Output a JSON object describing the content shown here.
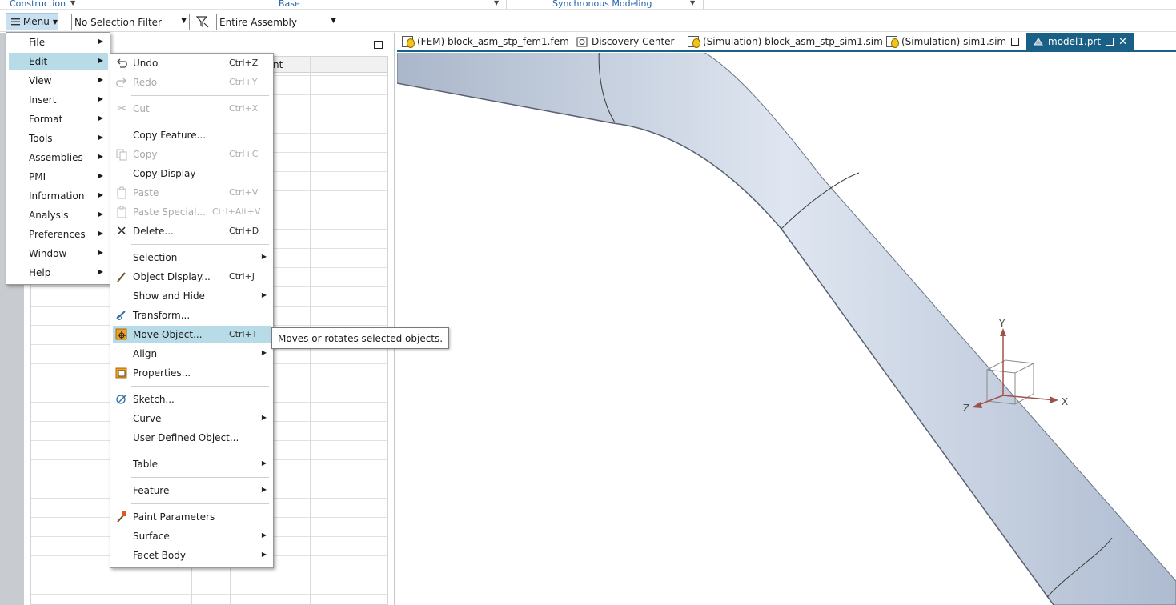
{
  "ribbon": {
    "groups": [
      {
        "label": "Construction"
      },
      {
        "label": "Base"
      },
      {
        "label": "Synchronous Modeling"
      }
    ]
  },
  "toolbar": {
    "menu_label": "Menu",
    "selection_filter": "No Selection Filter",
    "scope": "Entire Assembly"
  },
  "tabs": [
    {
      "label": "(FEM) block_asm_stp_fem1.fem"
    },
    {
      "label": "Discovery Center"
    },
    {
      "label": "(Simulation) block_asm_stp_sim1.sim"
    },
    {
      "label": "(Simulation) sim1.sim"
    },
    {
      "label": "model1.prt"
    }
  ],
  "navigator": {
    "column_fragment": "nt"
  },
  "main_menu": {
    "items": [
      {
        "label": "File"
      },
      {
        "label": "Edit"
      },
      {
        "label": "View"
      },
      {
        "label": "Insert"
      },
      {
        "label": "Format"
      },
      {
        "label": "Tools"
      },
      {
        "label": "Assemblies"
      },
      {
        "label": "PMI"
      },
      {
        "label": "Information"
      },
      {
        "label": "Analysis"
      },
      {
        "label": "Preferences"
      },
      {
        "label": "Window"
      },
      {
        "label": "Help"
      }
    ]
  },
  "edit_menu": {
    "items": [
      {
        "label": "Undo",
        "shortcut": "Ctrl+Z"
      },
      {
        "label": "Redo",
        "shortcut": "Ctrl+Y"
      },
      {
        "label": "Cut",
        "shortcut": "Ctrl+X"
      },
      {
        "label": "Copy Feature..."
      },
      {
        "label": "Copy",
        "shortcut": "Ctrl+C"
      },
      {
        "label": "Copy Display"
      },
      {
        "label": "Paste",
        "shortcut": "Ctrl+V"
      },
      {
        "label": "Paste Special...",
        "shortcut": "Ctrl+Alt+V"
      },
      {
        "label": "Delete...",
        "shortcut": "Ctrl+D"
      },
      {
        "label": "Selection"
      },
      {
        "label": "Object Display...",
        "shortcut": "Ctrl+J"
      },
      {
        "label": "Show and Hide"
      },
      {
        "label": "Transform..."
      },
      {
        "label": "Move Object...",
        "shortcut": "Ctrl+T"
      },
      {
        "label": "Align"
      },
      {
        "label": "Properties..."
      },
      {
        "label": "Sketch..."
      },
      {
        "label": "Curve"
      },
      {
        "label": "User Defined Object..."
      },
      {
        "label": "Table"
      },
      {
        "label": "Feature"
      },
      {
        "label": "Paint Parameters"
      },
      {
        "label": "Surface"
      },
      {
        "label": "Facet Body"
      }
    ]
  },
  "tooltip": {
    "text": "Moves or rotates selected objects."
  },
  "triad": {
    "x_label": "X",
    "y_label": "Y",
    "z_label": "Z"
  },
  "colors": {
    "accent_tab": "#1a5f86",
    "menu_highlight": "#b8dbe8",
    "pipe_body": "#c3cfe3",
    "triad_arrow": "#a0504a"
  }
}
